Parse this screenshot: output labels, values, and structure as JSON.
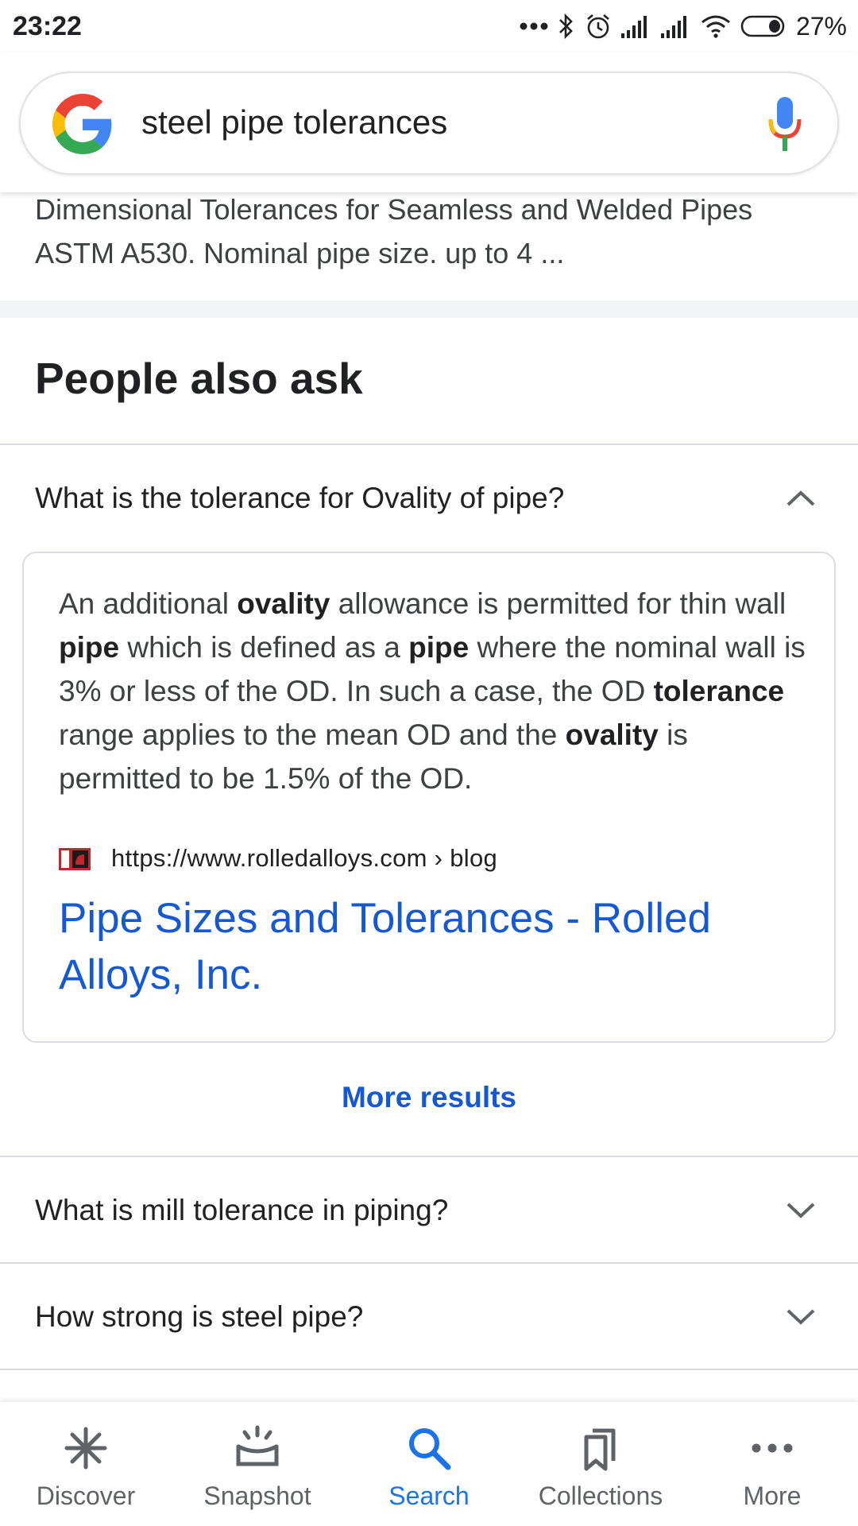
{
  "status_bar": {
    "time": "23:22",
    "battery": "27%"
  },
  "search": {
    "query": "steel pipe tolerances"
  },
  "snippet": {
    "line1": "Dimensional Tolerances for Seamless and Welded Pipes",
    "line2": "ASTM A530. Nominal pipe size. up to 4 ..."
  },
  "people_also_ask": {
    "title": "People also ask",
    "expanded_question": "What is the tolerance for Ovality of pipe?",
    "answer": {
      "segments": [
        {
          "text": "An additional ",
          "bold": false
        },
        {
          "text": "ovality",
          "bold": true
        },
        {
          "text": " allowance is permitted for thin wall ",
          "bold": false
        },
        {
          "text": "pipe",
          "bold": true
        },
        {
          "text": " which is defined as a ",
          "bold": false
        },
        {
          "text": "pipe",
          "bold": true
        },
        {
          "text": " where the nominal wall is 3% or less of the OD. In such a case, the OD ",
          "bold": false
        },
        {
          "text": "tolerance",
          "bold": true
        },
        {
          "text": " range applies to the mean OD and the ",
          "bold": false
        },
        {
          "text": "ovality",
          "bold": true
        },
        {
          "text": " is permitted to be 1.5% of the OD.",
          "bold": false
        }
      ],
      "source_url": "https://www.rolledalloys.com › blog",
      "result_title": "Pipe Sizes and Tolerances - Rolled Alloys, Inc."
    },
    "more_results": "More results",
    "questions": [
      "What is mill tolerance in piping?",
      "How strong is steel pipe?"
    ]
  },
  "bottom_nav": {
    "items": [
      {
        "label": "Discover",
        "icon": "asterisk-icon",
        "active": false
      },
      {
        "label": "Snapshot",
        "icon": "snapshot-icon",
        "active": false
      },
      {
        "label": "Search",
        "icon": "search-icon",
        "active": true
      },
      {
        "label": "Collections",
        "icon": "bookmarks-icon",
        "active": false
      },
      {
        "label": "More",
        "icon": "more-dots-icon",
        "active": false
      }
    ]
  },
  "colors": {
    "accent": "#1a73e8",
    "link": "#1558d6"
  }
}
